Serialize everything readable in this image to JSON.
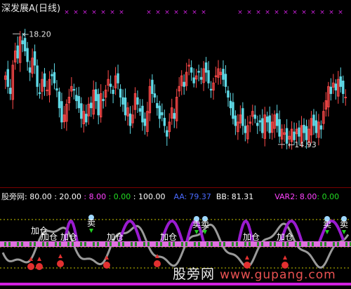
{
  "header": {
    "title": "深发展A",
    "period": "(日线)"
  },
  "indicator": {
    "name": "股旁网",
    "params": [
      {
        "text": ": 80.00",
        "color": "#ffffff"
      },
      {
        "text": " : 20.00",
        "color": "#ffffff"
      },
      {
        "text": " : 8.00",
        "color": "#ff44ff"
      },
      {
        "text": " : 0.00",
        "color": "#22dd22"
      },
      {
        "text": " : 100.00",
        "color": "#ffffff"
      }
    ],
    "aa_label": "AA:",
    "aa_value": "79.37",
    "bb_label": "BB:",
    "bb_value": "81.31",
    "var_label": "VAR2:",
    "var_value": "8.00",
    "var_value2": ": 0.00"
  },
  "signals": {
    "jiacang": "加仓",
    "mai": "卖"
  },
  "watermark": {
    "text": "股旁网",
    "url": "www.gupang.com"
  },
  "colors": {
    "up": "#ff4a4a",
    "down": "#5fd9e6",
    "magenta": "#d020e0",
    "purple": "#9a1bd0"
  },
  "chart_data": [
    {
      "type": "candlestick",
      "title": "深发展A(日线)",
      "ylim": [
        14.0,
        18.6
      ],
      "annotations": [
        {
          "label": "18.20",
          "value": 18.2
        },
        {
          "label": "14.93",
          "value": 14.93
        }
      ],
      "closes": [
        16.9,
        16.6,
        16.4,
        17.2,
        17.6,
        17.4,
        18.0,
        17.8,
        17.6,
        17.3,
        17.0,
        17.4,
        17.2,
        16.6,
        16.4,
        16.8,
        16.6,
        16.5,
        16.8,
        16.9,
        16.7,
        16.5,
        16.0,
        15.6,
        15.8,
        16.1,
        16.3,
        16.6,
        16.5,
        16.2,
        16.0,
        15.7,
        15.9,
        15.6,
        16.1,
        16.0,
        16.5,
        16.2,
        15.8,
        16.4,
        16.2,
        16.5,
        16.8,
        16.6,
        16.4,
        16.9,
        16.7,
        16.3,
        16.1,
        15.8,
        16.0,
        15.5,
        15.8,
        16.4,
        16.1,
        15.9,
        15.6,
        15.5,
        15.9,
        16.6,
        16.4,
        16.3,
        16.0,
        15.7,
        15.8,
        15.5,
        15.2,
        15.6,
        16.0,
        15.7,
        16.3,
        16.6,
        16.9,
        16.6,
        17.0,
        17.2,
        17.0,
        16.7,
        16.9,
        17.0,
        16.8,
        17.1,
        17.0,
        16.7,
        16.5,
        16.7,
        16.9,
        17.1,
        17.0,
        16.8,
        16.6,
        16.3,
        16.0,
        15.7,
        15.5,
        15.6,
        15.8,
        15.5,
        15.3,
        15.5,
        15.6,
        15.9,
        15.7,
        15.5,
        15.6,
        15.3,
        15.8,
        15.6,
        15.3,
        15.6,
        15.8,
        15.5,
        15.2,
        15.4,
        15.3,
        15.0,
        15.2,
        15.4,
        15.1,
        15.4,
        15.2,
        15.5,
        15.3,
        15.1,
        15.4,
        15.7,
        15.5,
        15.3,
        15.6,
        15.4,
        15.9,
        16.2,
        16.6,
        16.4,
        16.7,
        16.5,
        16.8,
        16.6,
        16.4,
        16.3
      ],
      "signal_groups": [
        {
          "x": 0.09,
          "kind": "buy"
        },
        {
          "x": 0.17,
          "kind": "buy"
        },
        {
          "x": 0.3,
          "kind": "buy"
        },
        {
          "x": 0.45,
          "kind": "buy"
        },
        {
          "x": 0.7,
          "kind": "buy"
        }
      ]
    }
  ]
}
